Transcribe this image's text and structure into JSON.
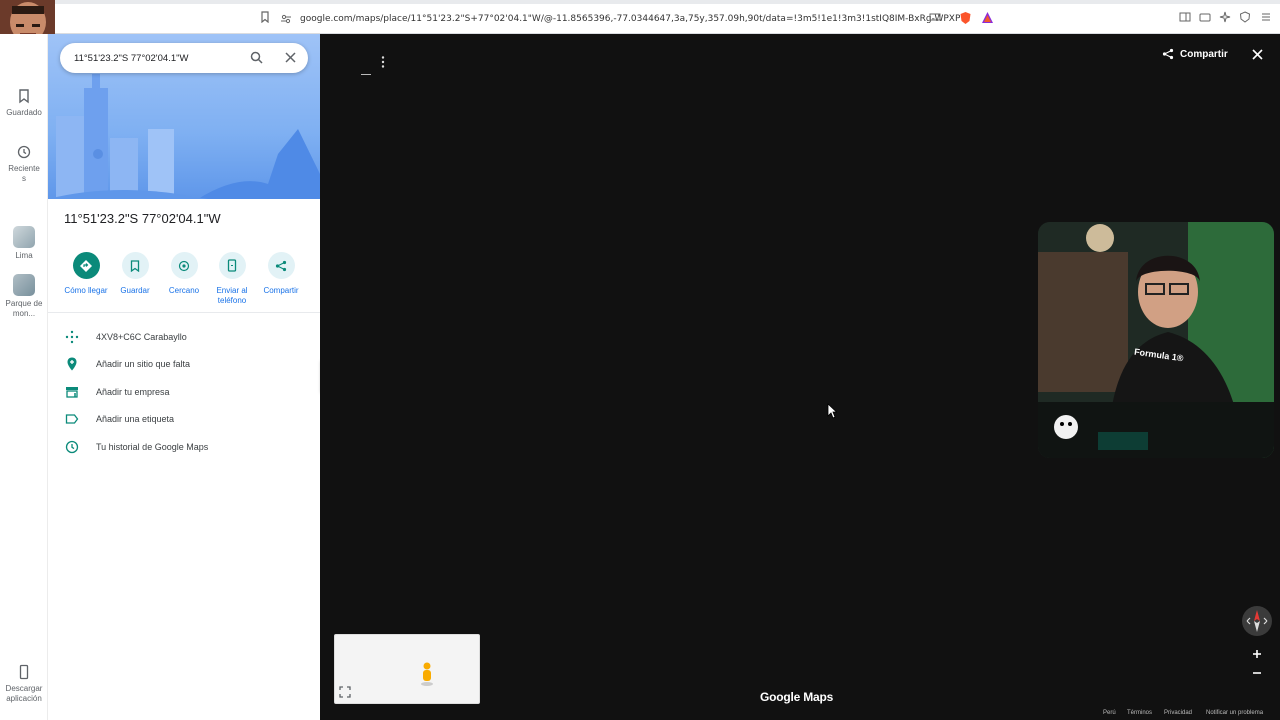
{
  "browser": {
    "url": "google.com/maps/place/11°51'23.2\"S+77°02'04.1\"W/@-11.8565396,-77.0344647,3a,75y,357.09h,90t/data=!3m5!1e1!3m3!1stIQ8IM-BxRg-WPXP_b..."
  },
  "overlay": {
    "badge_text": "x95"
  },
  "rail": {
    "items": [
      {
        "label": "Guardado",
        "icon": "bookmark-icon"
      },
      {
        "label": "Reciente s",
        "icon": "history-icon"
      },
      {
        "label": "Lima",
        "icon": "thumbnail"
      },
      {
        "label": "Parque de mon...",
        "icon": "thumbnail"
      }
    ],
    "download_label": "Descargar aplicación"
  },
  "search": {
    "value": "11°51'23.2\"S 77°02'04.1\"W"
  },
  "place": {
    "title": "11°51'23.2\"S 77°02'04.1\"W",
    "actions": [
      {
        "label": "Cómo llegar",
        "icon": "directions-icon"
      },
      {
        "label": "Guardar",
        "icon": "bookmark-icon"
      },
      {
        "label": "Cercano",
        "icon": "nearby-icon"
      },
      {
        "label": "Enviar al teléfono",
        "icon": "phone-icon"
      },
      {
        "label": "Compartir",
        "icon": "share-icon"
      }
    ],
    "info_rows": [
      {
        "label": "4XV8+C6C Carabayllo",
        "icon": "plus-code-icon"
      },
      {
        "label": "Añadir un sitio que falta",
        "icon": "add-place-icon"
      },
      {
        "label": "Añadir tu empresa",
        "icon": "store-icon"
      },
      {
        "label": "Añadir una etiqueta",
        "icon": "label-icon"
      },
      {
        "label": "Tu historial de Google Maps",
        "icon": "history-icon"
      }
    ]
  },
  "map": {
    "share_label": "Compartir",
    "brand": "Google Maps",
    "footer": [
      "Perú",
      "Términos",
      "Privacidad",
      "Notificar un problema"
    ],
    "webcam_shirt_text": "Formula 1®"
  },
  "colors": {
    "accent": "#1a73e8",
    "primary_action": "#0b8a7a",
    "map_bg": "#111111"
  }
}
